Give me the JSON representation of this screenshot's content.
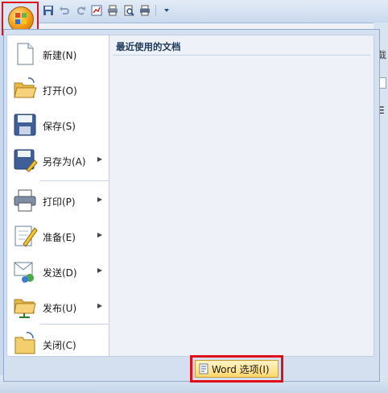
{
  "right_edge": {
    "text": "载",
    "lines": "☰"
  },
  "menu": {
    "items": [
      {
        "label": "新建(N)",
        "icon": "new-document-icon",
        "arrow": false
      },
      {
        "label": "打开(O)",
        "icon": "open-folder-icon",
        "arrow": false
      },
      {
        "label": "保存(S)",
        "icon": "save-disk-icon",
        "arrow": false
      },
      {
        "label": "另存为(A)",
        "icon": "save-as-icon",
        "arrow": true
      },
      {
        "label": "打印(P)",
        "icon": "printer-icon",
        "arrow": true
      },
      {
        "label": "准备(E)",
        "icon": "prepare-pen-icon",
        "arrow": true
      },
      {
        "label": "发送(D)",
        "icon": "send-icon",
        "arrow": true
      },
      {
        "label": "发布(U)",
        "icon": "publish-folder-icon",
        "arrow": true
      },
      {
        "label": "关闭(C)",
        "icon": "close-folder-icon",
        "arrow": false
      }
    ],
    "recent_title": "最近使用的文档",
    "arrow_glyph": "▶"
  },
  "footer": {
    "word_options_label": "Word 选项(I)"
  },
  "colors": {
    "highlight_border": "#e0101b",
    "menu_bg": "#d4dfef"
  }
}
